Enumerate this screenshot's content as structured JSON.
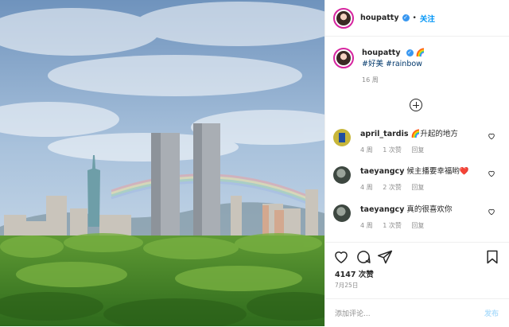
{
  "header": {
    "username": "houpatty",
    "dot": "•",
    "follow_label": "关注"
  },
  "caption": {
    "username": "houpatty",
    "emoji": "🌈",
    "hashtags": "#好美 #rainbow",
    "time": "16 周"
  },
  "comments": [
    {
      "username": "april_tardis",
      "text": "🌈升起的地方",
      "age": "4 周",
      "likes": "1 次赞",
      "reply": "回复"
    },
    {
      "username": "taeyangcy",
      "text": "候主播要幸福哟❤️",
      "age": "4 周",
      "likes": "2 次赞",
      "reply": "回复"
    },
    {
      "username": "taeyangcy",
      "text": "真的很喜欢你",
      "age": "4 周",
      "likes": "1 次赞",
      "reply": "回复"
    }
  ],
  "post": {
    "likes": "4147 次赞",
    "date": "7月25日"
  },
  "add_comment": {
    "placeholder": "添加评论...",
    "post_label": "发布"
  },
  "icons": {
    "verified": "verified-badge-icon",
    "load_more": "plus-circle-icon",
    "like": "heart-icon",
    "comment": "speech-bubble-icon",
    "share": "paper-plane-icon",
    "save": "bookmark-icon"
  },
  "colors": {
    "accent_blue": "#0095f6",
    "hashtag": "#00376b",
    "muted": "#8e8e8e",
    "post_disabled": "#b2dffc"
  }
}
